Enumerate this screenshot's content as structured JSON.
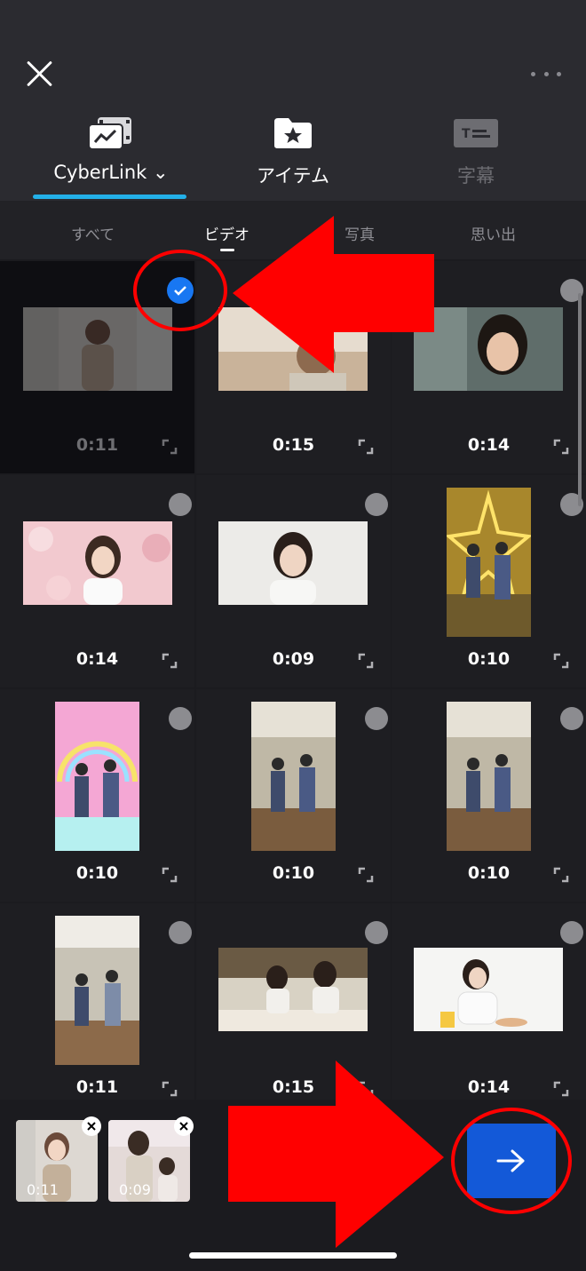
{
  "header": {
    "source_tabs": [
      {
        "label": "CyberLink",
        "icon": "media-library-icon",
        "active": true
      },
      {
        "label": "アイテム",
        "icon": "star-folder-icon",
        "active": false
      },
      {
        "label": "字幕",
        "icon": "subtitle-icon",
        "active": false,
        "disabled": true
      }
    ]
  },
  "subtabs": [
    {
      "label": "すべて",
      "active": false
    },
    {
      "label": "ビデオ",
      "active": true
    },
    {
      "label": "写真",
      "active": false
    },
    {
      "label": "思い出",
      "active": false
    }
  ],
  "grid": {
    "items": [
      {
        "duration": "0:11",
        "selected": true,
        "orientation": "landscape"
      },
      {
        "duration": "0:15",
        "selected": false,
        "orientation": "landscape"
      },
      {
        "duration": "0:14",
        "selected": false,
        "orientation": "landscape"
      },
      {
        "duration": "0:14",
        "selected": false,
        "orientation": "landscape"
      },
      {
        "duration": "0:09",
        "selected": false,
        "orientation": "landscape"
      },
      {
        "duration": "0:10",
        "selected": false,
        "orientation": "portrait"
      },
      {
        "duration": "0:10",
        "selected": false,
        "orientation": "portrait"
      },
      {
        "duration": "0:10",
        "selected": false,
        "orientation": "portrait"
      },
      {
        "duration": "0:10",
        "selected": false,
        "orientation": "portrait"
      },
      {
        "duration": "0:11",
        "selected": false,
        "orientation": "portrait"
      },
      {
        "duration": "0:15",
        "selected": false,
        "orientation": "landscape"
      },
      {
        "duration": "0:14",
        "selected": false,
        "orientation": "landscape"
      }
    ]
  },
  "tray": {
    "items": [
      {
        "duration": "0:11"
      },
      {
        "duration": "0:09"
      }
    ]
  },
  "colors": {
    "accent_underline": "#23b0e8",
    "check_badge": "#1877f2",
    "next_button": "#1359d8",
    "annotation": "#ff0000"
  }
}
